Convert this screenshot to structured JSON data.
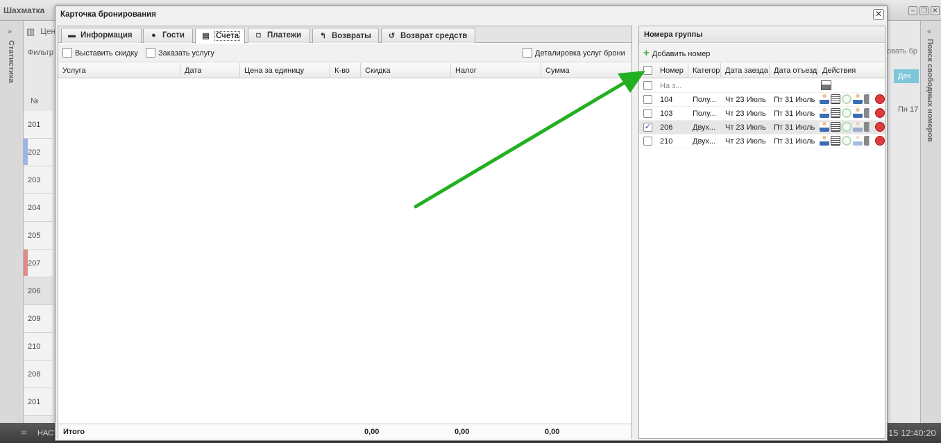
{
  "background_app": {
    "title": "Шахматка",
    "left_sidebar_label": "Статистика",
    "right_sidebar_label": "Поиск свободных номеров",
    "price_label": "Цен",
    "filter_label": "Фильтр",
    "search_stub": "овать бр",
    "month_label": "Дек",
    "day_label": "Пн 17",
    "number_header": "№",
    "rooms": [
      "201",
      "202",
      "203",
      "204",
      "205",
      "207",
      "206",
      "209",
      "210",
      "208",
      "201"
    ],
    "taskbar_left": "НАСТ",
    "clock": "15 12:40:20"
  },
  "modal": {
    "title": "Карточка бронирования",
    "close_glyph": "✕",
    "tabs": [
      {
        "label": "Информация",
        "icon": "briefcase-icon"
      },
      {
        "label": "Гости",
        "icon": "users-icon"
      },
      {
        "label": "Счета",
        "icon": "document-icon",
        "active": true
      },
      {
        "label": "Платежи",
        "icon": "cash-icon"
      },
      {
        "label": "Возвраты",
        "icon": "undo-arrow-icon"
      },
      {
        "label": "Возврат средств",
        "icon": "refresh-icon"
      }
    ],
    "toolbar": {
      "discount": "Выставить скидку",
      "order_service": "Заказать услугу",
      "detailing": "Деталировка услуг брони"
    },
    "columns": [
      "Услуга",
      "Дата",
      "Цена за единицу",
      "К-во",
      "Скидка",
      "Налог",
      "Сумма"
    ],
    "footer": {
      "total_label": "Итого",
      "discount_total": "0,00",
      "tax_total": "0,00",
      "sum_total": "0,00"
    }
  },
  "group": {
    "title": "Номера группы",
    "add_room": "Добавить номер",
    "columns": [
      "Номер",
      "Категор",
      "Дата заезда",
      "Дата отъезд",
      "Действия"
    ],
    "placeholder_row": "На з...",
    "rows": [
      {
        "number": "104",
        "category": "Полу...",
        "arrival": "Чт 23 Июль",
        "departure": "Пт 31 Июль",
        "checked": false
      },
      {
        "number": "103",
        "category": "Полу...",
        "arrival": "Чт 23 Июль",
        "departure": "Пт 31 Июль",
        "checked": false
      },
      {
        "number": "206",
        "category": "Двух...",
        "arrival": "Чт 23 Июль",
        "departure": "Пт 31 Июль",
        "checked": true
      },
      {
        "number": "210",
        "category": "Двух...",
        "arrival": "Чт 23 Июль",
        "departure": "Пт 31 Июль",
        "checked": false
      }
    ]
  },
  "annotation": {
    "arrow_color": "#22b022"
  }
}
